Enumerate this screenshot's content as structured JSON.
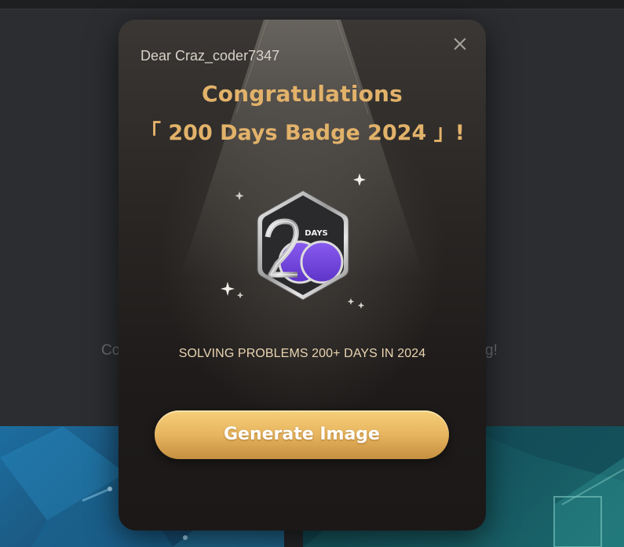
{
  "background": {
    "text_left": "Co",
    "text_right": "g!"
  },
  "modal": {
    "greeting": "Dear Craz_coder7347",
    "title_line1": "Congratulations",
    "title_line2": "「 200 Days Badge 2024 」!",
    "badge": {
      "label": "DAYS",
      "number": "200",
      "icon": "badge-200-days-icon"
    },
    "caption": "SOLVING PROBLEMS 200+ DAYS IN 2024",
    "button_label": "Generate Image",
    "close_icon": "close-icon"
  },
  "colors": {
    "accent_gold": "#e2b26a",
    "badge_purple": "#7b4fe0",
    "button_gold": "#e7b45f"
  }
}
